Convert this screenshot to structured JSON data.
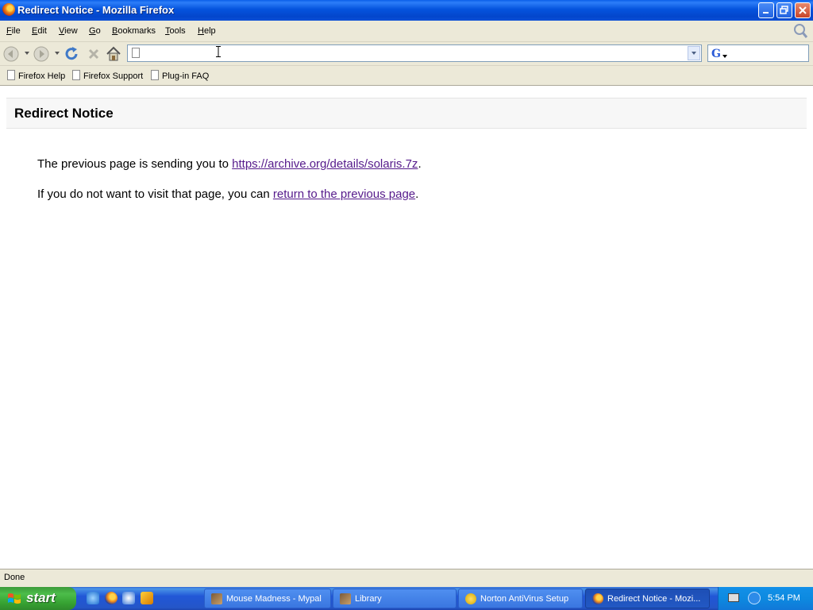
{
  "window": {
    "title": "Redirect Notice - Mozilla Firefox",
    "icon": "firefox-icon"
  },
  "menubar": {
    "items": [
      "File",
      "Edit",
      "View",
      "Go",
      "Bookmarks",
      "Tools",
      "Help"
    ]
  },
  "navbar": {
    "buttons": [
      "back-icon",
      "back-dropdown-icon",
      "forward-icon",
      "forward-dropdown-icon",
      "reload-icon",
      "stop-icon",
      "home-icon"
    ],
    "url": "",
    "search_engine_icon": "google-icon",
    "search_value": ""
  },
  "bookmarks": {
    "items": [
      "Firefox Help",
      "Firefox Support",
      "Plug-in FAQ"
    ]
  },
  "page": {
    "heading": "Redirect Notice",
    "line1_prefix": "The previous page is sending you to ",
    "line1_link": "https://archive.org/details/solaris.7z",
    "line1_suffix": ".",
    "line2_prefix": "If you do not want to visit that page, you can ",
    "line2_link": "return to the previous page",
    "line2_suffix": "."
  },
  "statusbar": {
    "status": "Done"
  },
  "taskbar": {
    "start_label": "start",
    "quick_launch": [
      "ie-icon",
      "firefox-icon",
      "outlook-icon",
      "app-icon"
    ],
    "tasks": [
      {
        "label": "Mouse Madness - Mypal",
        "icon": "mypal-icon",
        "active": false
      },
      {
        "label": "Library",
        "icon": "mypal-icon",
        "active": false
      },
      {
        "label": "Norton AntiVirus Setup",
        "icon": "norton-icon",
        "active": false
      },
      {
        "label": "Redirect Notice - Mozi...",
        "icon": "firefox-icon",
        "active": true
      }
    ],
    "clock": "5:54 PM"
  },
  "colors": {
    "titlebar_blue": "#0553dd",
    "chrome_beige": "#ece9d8",
    "visited_link": "#551a8b",
    "start_green": "#36a232",
    "taskbar_blue": "#2157d7"
  }
}
